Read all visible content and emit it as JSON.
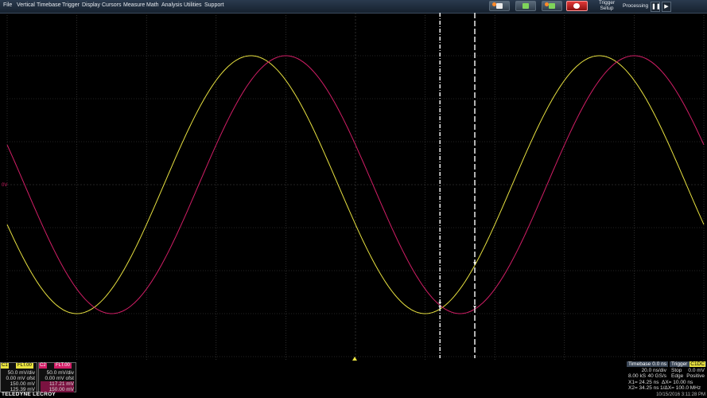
{
  "menu": [
    "File",
    "Vertical",
    "Timebase",
    "Trigger",
    "Display",
    "Cursors",
    "Measure",
    "Math",
    "Analysis",
    "Utilities",
    "Support"
  ],
  "toolbar": {
    "trigger_setup_line1": "Trigger",
    "trigger_setup_line2": "Setup",
    "processing_label": "Processing"
  },
  "colors": {
    "ch1": "#e9e240",
    "ch2": "#d21e66",
    "grid": "#4a4a4a",
    "cursor": "#ffffff"
  },
  "screen": {
    "zero_marker": "0V",
    "waveforms": [
      {
        "name": "C1",
        "amplitude_V": 0.15,
        "period_ns": 100,
        "phase_deg": 198
      },
      {
        "name": "C2",
        "amplitude_V": 0.15,
        "period_ns": 100,
        "phase_deg": 162
      }
    ],
    "cursor_x_ns": [
      24.25,
      34.25
    ]
  },
  "channels": {
    "c1": {
      "tag": "C1",
      "name": "FLT.00",
      "vdiv": "50.0 mV/div",
      "offset": "0.00 mV ofst",
      "v1": "150.00 mV",
      "v2": "125.39 mV"
    },
    "c2": {
      "tag": "C2",
      "name": "FLT.00",
      "vdiv": "50.0 mV/div",
      "offset": "0.00 mV ofst",
      "v1": "117.21 mV",
      "v2": "150.00 mV"
    }
  },
  "timebase": {
    "label": "Timebase",
    "delay": "0.0 ns",
    "tdiv": "20.0 ns/div",
    "samples": "8.00 kS",
    "rate": "40 GS/s",
    "x1": "X1=  24.25 ns",
    "dx": "ΔX=     10.00 ns",
    "x2": "X2=  34.25 ns",
    "inv_dx": "1/ΔX= 100.0 MHz"
  },
  "trigger": {
    "label": "Trigger",
    "source": "C1DC",
    "mode": "Stop",
    "level": "0.0 mV",
    "type": "Edge",
    "slope": "Positive"
  },
  "brand": "TELEDYNE LECROY",
  "timestamp": "10/15/2016 3:11:28 PM"
}
